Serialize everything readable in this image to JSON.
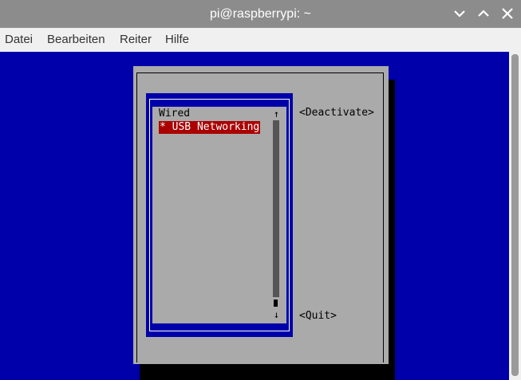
{
  "window": {
    "title": "pi@raspberrypi: ~",
    "controls": [
      "minimize-icon",
      "maximize-icon",
      "close-icon"
    ]
  },
  "menubar": {
    "items": [
      "Datei",
      "Bearbeiten",
      "Reiter",
      "Hilfe"
    ]
  },
  "dialog": {
    "connections": {
      "group_label": "Wired",
      "selected_item": "* USB Networking",
      "scroll_up": "↑",
      "scroll_down": "↓"
    },
    "buttons": {
      "deactivate": "<Deactivate>",
      "quit": "<Quit>"
    }
  },
  "colors": {
    "titlebar": "#8c8c8c",
    "menubar": "#f0f0f0",
    "terminal_bg": "#0000aa",
    "dialog_bg": "#aaaaaa",
    "selection_bg": "#aa0000",
    "selection_text": "#ffffff"
  }
}
